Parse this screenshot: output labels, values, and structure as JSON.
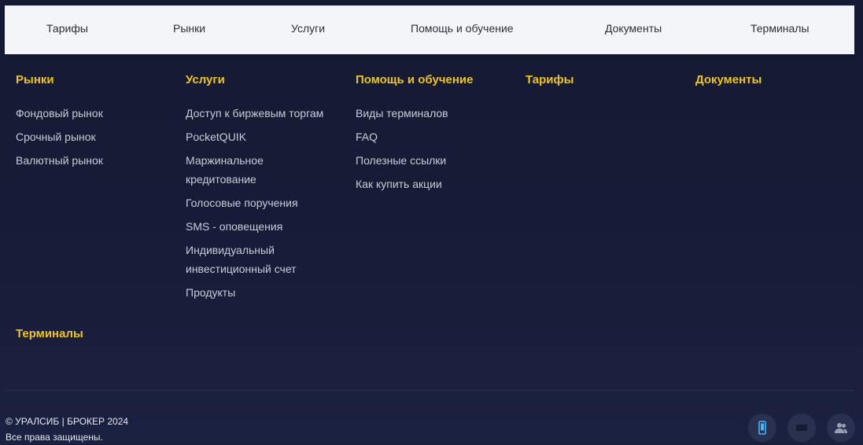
{
  "topnav": [
    "Тарифы",
    "Рынки",
    "Услуги",
    "Помощь и обучение",
    "Документы",
    "Терминалы"
  ],
  "columns": [
    {
      "title": "Рынки",
      "links": [
        "Фондовый рынок",
        "Срочный рынок",
        "Валютный рынок"
      ]
    },
    {
      "title": "Услуги",
      "links": [
        "Доступ к биржевым торгам",
        "PocketQUIK",
        "Маржинальное кредитование",
        "Голосовые поручения",
        "SMS - оповещения",
        "Индивидуальный инвестиционный счет",
        "Продукты"
      ]
    },
    {
      "title": "Помощь и обучение",
      "links": [
        "Виды терминалов",
        "FAQ",
        "Полезные ссылки",
        "Как купить акции"
      ]
    },
    {
      "title": "Тарифы",
      "links": []
    },
    {
      "title": "Документы",
      "links": []
    }
  ],
  "terminals_heading": "Терминалы",
  "footer": {
    "copyright": "© УРАЛСИБ | БРОКЕР 2024",
    "rights": "Все права защищены."
  },
  "social_icons": [
    "mobile-phone-icon",
    "video-icon",
    "community-icon"
  ],
  "colors": {
    "accent": "#f0c419",
    "background": "#171d38",
    "nav_background": "#f4f5f8",
    "link": "#c9ccd6"
  }
}
